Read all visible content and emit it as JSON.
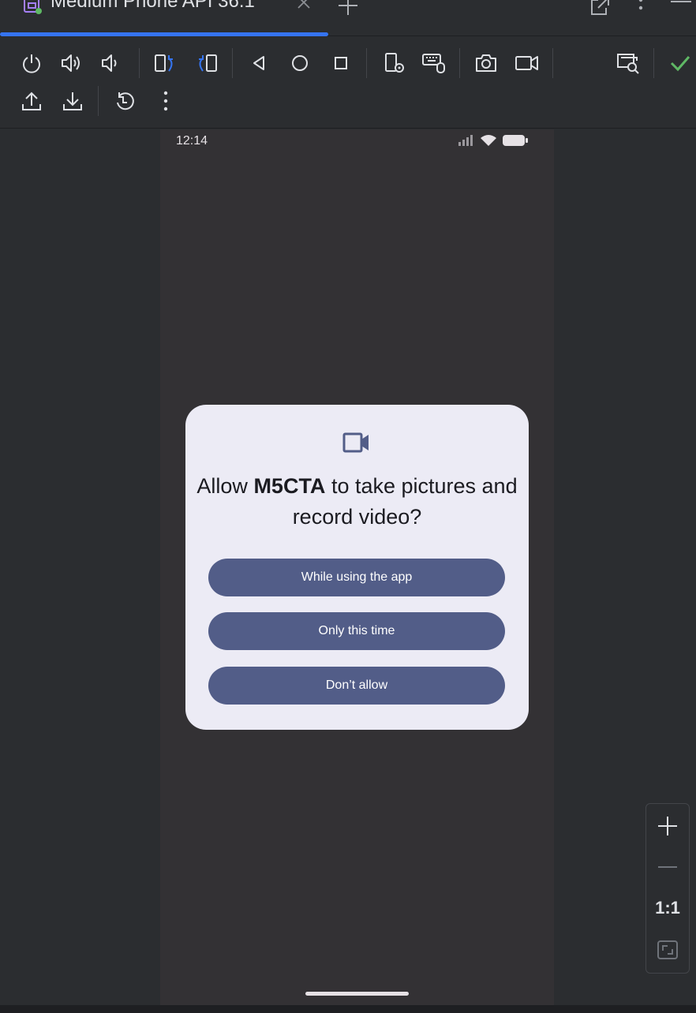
{
  "tab": {
    "title": "Medium Phone API 36.1"
  },
  "toolbar": {
    "row1": [
      "power-icon",
      "volume-up-icon",
      "volume-down-icon",
      "rotate-left-icon",
      "rotate-right-icon",
      "back-icon",
      "home-icon",
      "overview-icon",
      "device-settings-icon",
      "keyboard-mouse-icon",
      "camera-snapshot-icon",
      "screen-record-icon",
      "inspect-icon",
      "check-icon"
    ],
    "row2": [
      "upload-icon",
      "download-icon",
      "reset-icon",
      "more-vertical-icon"
    ]
  },
  "device": {
    "status_time": "12:14",
    "dialog": {
      "title_prefix": "Allow ",
      "app_name": "M5CTA",
      "title_suffix": " to take pictures and record video?",
      "buttons": {
        "while_using": "While using the app",
        "only_this_time": "Only this time",
        "dont_allow": "Don’t allow"
      }
    }
  },
  "zoom": {
    "one_to_one": "1:1"
  },
  "colors": {
    "accent": "#3574f0",
    "dialog_bg": "#ecebf5",
    "dialog_button": "#525d88",
    "success": "#5fb865"
  }
}
